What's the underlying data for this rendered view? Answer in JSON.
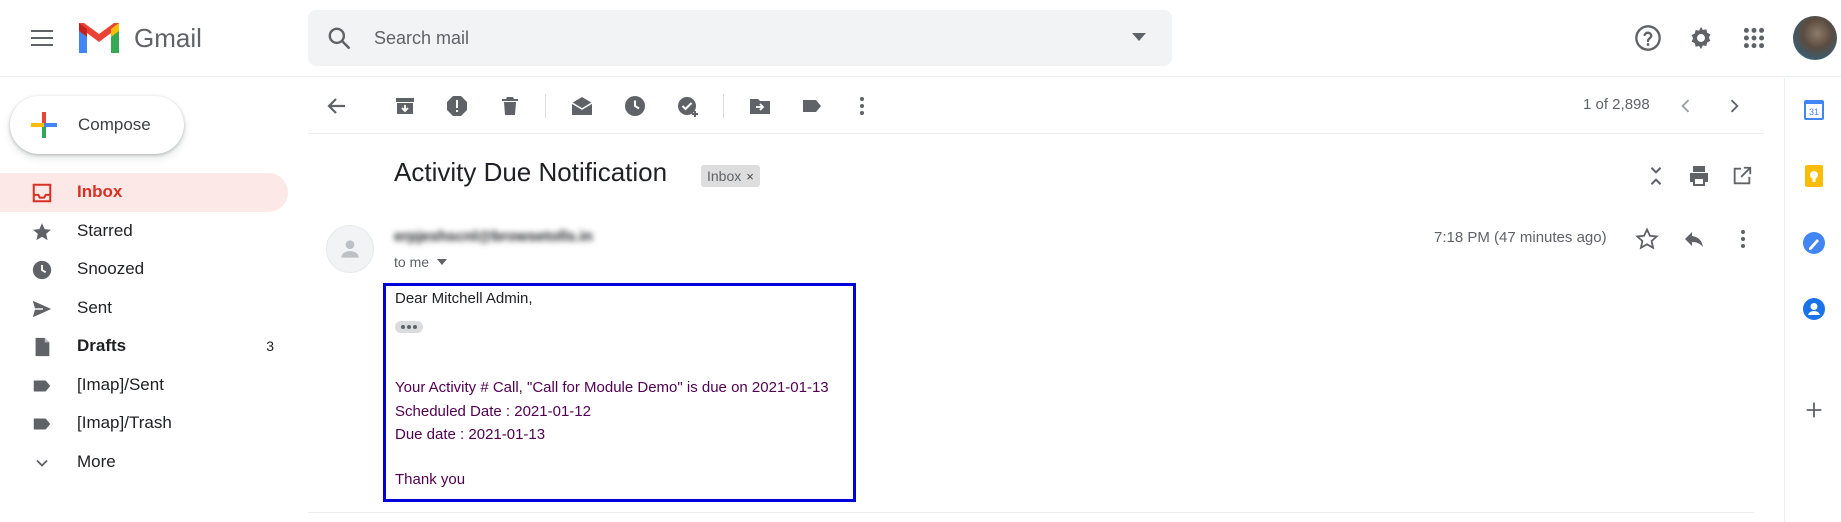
{
  "app": {
    "logo_text": "Gmail"
  },
  "search": {
    "placeholder": "Search mail",
    "value": ""
  },
  "compose": {
    "label": "Compose"
  },
  "sidebar": {
    "items": [
      {
        "label": "Inbox",
        "count": "",
        "icon": "inbox-icon",
        "active": true
      },
      {
        "label": "Starred",
        "count": "",
        "icon": "star-icon"
      },
      {
        "label": "Snoozed",
        "count": "",
        "icon": "clock-icon"
      },
      {
        "label": "Sent",
        "count": "",
        "icon": "send-icon"
      },
      {
        "label": "Drafts",
        "count": "3",
        "icon": "draft-icon"
      },
      {
        "label": "[Imap]/Sent",
        "count": "",
        "icon": "label-icon"
      },
      {
        "label": "[Imap]/Trash",
        "count": "",
        "icon": "label-icon"
      },
      {
        "label": "More",
        "count": "",
        "icon": "chevron-down-icon"
      }
    ]
  },
  "toolbar": {
    "pager": "1 of 2,898",
    "icons": [
      "back-icon",
      "archive-icon",
      "report-spam-icon",
      "delete-icon",
      "mark-unread-icon",
      "snooze-icon",
      "add-task-icon",
      "move-to-icon",
      "label-icon",
      "more-vert-icon",
      "prev-icon",
      "next-icon"
    ]
  },
  "email": {
    "subject": "Activity Due Notification",
    "label_chip": "Inbox",
    "label_chip_remove": "×",
    "sender": "erpjeshscnl@browsetolls.in",
    "to": "to me",
    "timestamp": "7:18 PM (47 minutes ago)",
    "body": {
      "greeting": "Dear Mitchell Admin,",
      "line1": "Your Activity # Call, \"Call for Module Demo\" is due on 2021-01-13",
      "line2": "Scheduled Date : 2021-01-12",
      "line3": "Due date : 2021-01-13",
      "line4": "Thank you"
    }
  },
  "colors": {
    "accent": "#d93025",
    "highlight_box": "#0000dd",
    "body_text": "#500050",
    "active_nav_bg": "#fce8e6"
  }
}
